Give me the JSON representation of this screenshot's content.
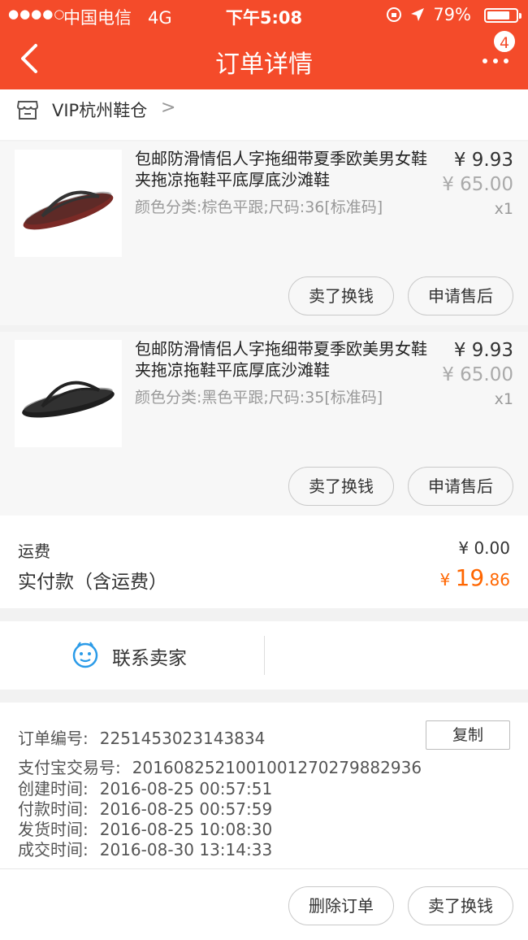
{
  "status_bar": {
    "signal": "●●●●○",
    "carrier": "中国电信",
    "network": "4G",
    "time": "下午5:08",
    "battery": "79%",
    "battery_level": 0.79
  },
  "nav": {
    "title": "订单详情",
    "badge": "4"
  },
  "shop": {
    "name": "VIP杭州鞋仓"
  },
  "items": [
    {
      "title": "包邮防滑情侣人字拖细带夏季欧美男女鞋夹拖凉拖鞋平底厚底沙滩鞋",
      "spec": "颜色分类:棕色平跟;尺码:36[标准码]",
      "price": "¥ 9.93",
      "original_price": "¥ 65.00",
      "quantity": "x1",
      "sell_label": "卖了换钱",
      "aftersale_label": "申请售后",
      "sole_color": "#7a2a26"
    },
    {
      "title": "包邮防滑情侣人字拖细带夏季欧美男女鞋夹拖凉拖鞋平底厚底沙滩鞋",
      "spec": "颜色分类:黑色平跟;尺码:35[标准码]",
      "price": "¥ 9.93",
      "original_price": "¥ 65.00",
      "quantity": "x1",
      "sell_label": "卖了换钱",
      "aftersale_label": "申请售后",
      "sole_color": "#1e1e1e"
    }
  ],
  "fees": {
    "shipping_label": "运费",
    "shipping_value": "¥ 0.00",
    "paid_label": "实付款（含运费）",
    "paid_symbol": "¥ ",
    "paid_integer": "19",
    "paid_decimal": ".86"
  },
  "contact": {
    "label": "联系卖家"
  },
  "order_info": {
    "order_no_label": "订单编号:",
    "order_no": "2251453023143834",
    "copy_label": "复制",
    "alipay_label": "支付宝交易号:",
    "alipay_no": "2016082521001001270279882936",
    "created_label": "创建时间:",
    "created": "2016-08-25 00:57:51",
    "paid_label": "付款时间:",
    "paid": "2016-08-25 00:57:59",
    "shipped_label": "发货时间:",
    "shipped": "2016-08-25 10:08:30",
    "closed_label": "成交时间:",
    "closed": "2016-08-30 13:14:33"
  },
  "footer": {
    "delete_label": "删除订单",
    "sell_label": "卖了换钱"
  },
  "colors": {
    "brand": "#f44b2a",
    "price_highlight": "#ff6600"
  }
}
